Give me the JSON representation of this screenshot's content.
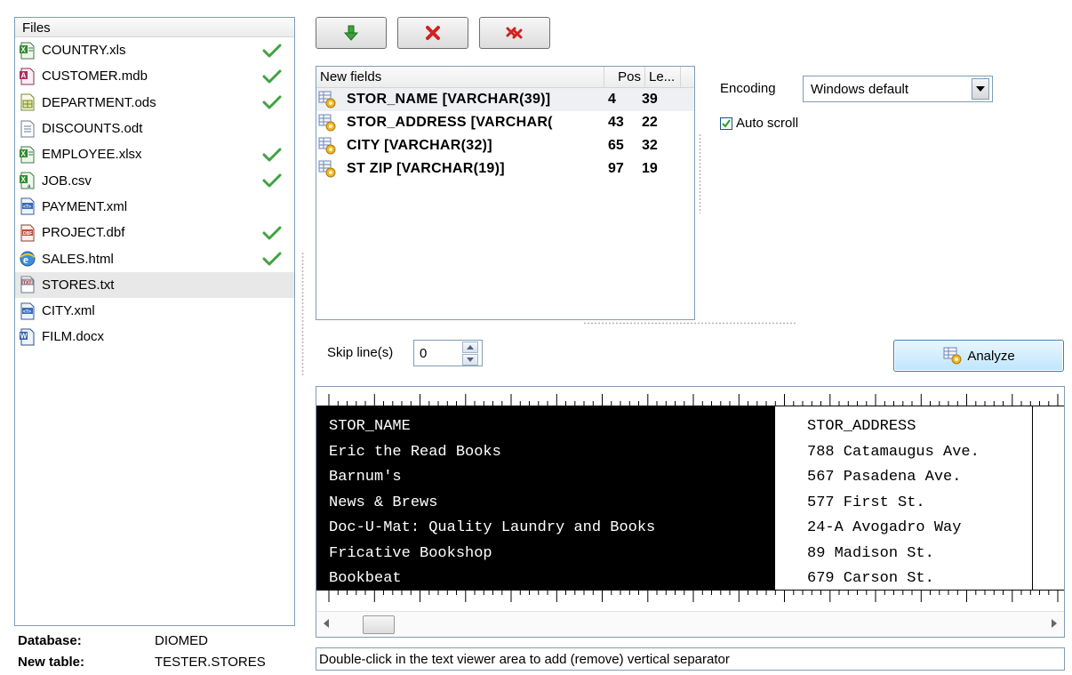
{
  "files_panel": {
    "header": "Files",
    "items": [
      {
        "name": "COUNTRY.xls",
        "icon": "excel-icon",
        "checked": true
      },
      {
        "name": "CUSTOMER.mdb",
        "icon": "access-icon",
        "checked": true
      },
      {
        "name": "DEPARTMENT.ods",
        "icon": "spreadsheet-icon",
        "checked": true
      },
      {
        "name": "DISCOUNTS.odt",
        "icon": "text-document-icon",
        "checked": false
      },
      {
        "name": "EMPLOYEE.xlsx",
        "icon": "excel-icon",
        "checked": true
      },
      {
        "name": "JOB.csv",
        "icon": "csv-icon",
        "checked": true
      },
      {
        "name": "PAYMENT.xml",
        "icon": "xml-icon",
        "checked": false
      },
      {
        "name": "PROJECT.dbf",
        "icon": "dbf-icon",
        "checked": true
      },
      {
        "name": "SALES.html",
        "icon": "html-icon",
        "checked": true
      },
      {
        "name": "STORES.txt",
        "icon": "txt-icon",
        "checked": false,
        "selected": true
      },
      {
        "name": "CITY.xml",
        "icon": "xml-icon",
        "checked": false
      },
      {
        "name": "FILM.docx",
        "icon": "word-icon",
        "checked": false
      }
    ]
  },
  "info": {
    "database_label": "Database:",
    "database_value": "DIOMED",
    "new_table_label": "New table:",
    "new_table_value": "TESTER.STORES"
  },
  "toolbar": {
    "buttons": [
      "arrow-down-icon",
      "delete-icon",
      "delete-all-icon"
    ]
  },
  "fields": {
    "columns": [
      "New fields",
      "Pos",
      "Le..."
    ],
    "rows": [
      {
        "name": "STOR_NAME  [VARCHAR(39)]",
        "pos": "4",
        "len": "39"
      },
      {
        "name": "STOR_ADDRESS  [VARCHAR(",
        "pos": "43",
        "len": "22"
      },
      {
        "name": "CITY  [VARCHAR(32)]",
        "pos": "65",
        "len": "32"
      },
      {
        "name": "ST ZIP  [VARCHAR(19)]",
        "pos": "97",
        "len": "19"
      }
    ]
  },
  "encoding": {
    "label": "Encoding",
    "value": "Windows default"
  },
  "autoscroll": {
    "label": "Auto scroll",
    "checked": true
  },
  "skip": {
    "label": "Skip line(s)",
    "value": "0"
  },
  "analyze": {
    "label": "Analyze"
  },
  "viewer": {
    "col1": [
      "STOR_NAME",
      "Eric the Read Books",
      "Barnum's",
      "News & Brews",
      "Doc-U-Mat: Quality Laundry and Books",
      "Fricative Bookshop",
      "Bookbeat"
    ],
    "col2": [
      "STOR_ADDRESS",
      "788 Catamaugus Ave.",
      "567 Pasadena Ave.",
      "577 First St.",
      "24-A Avogadro Way",
      "89 Madison St.",
      "679 Carson St."
    ]
  },
  "status": {
    "text": "Double-click in the text viewer area to add (remove) vertical separator"
  }
}
